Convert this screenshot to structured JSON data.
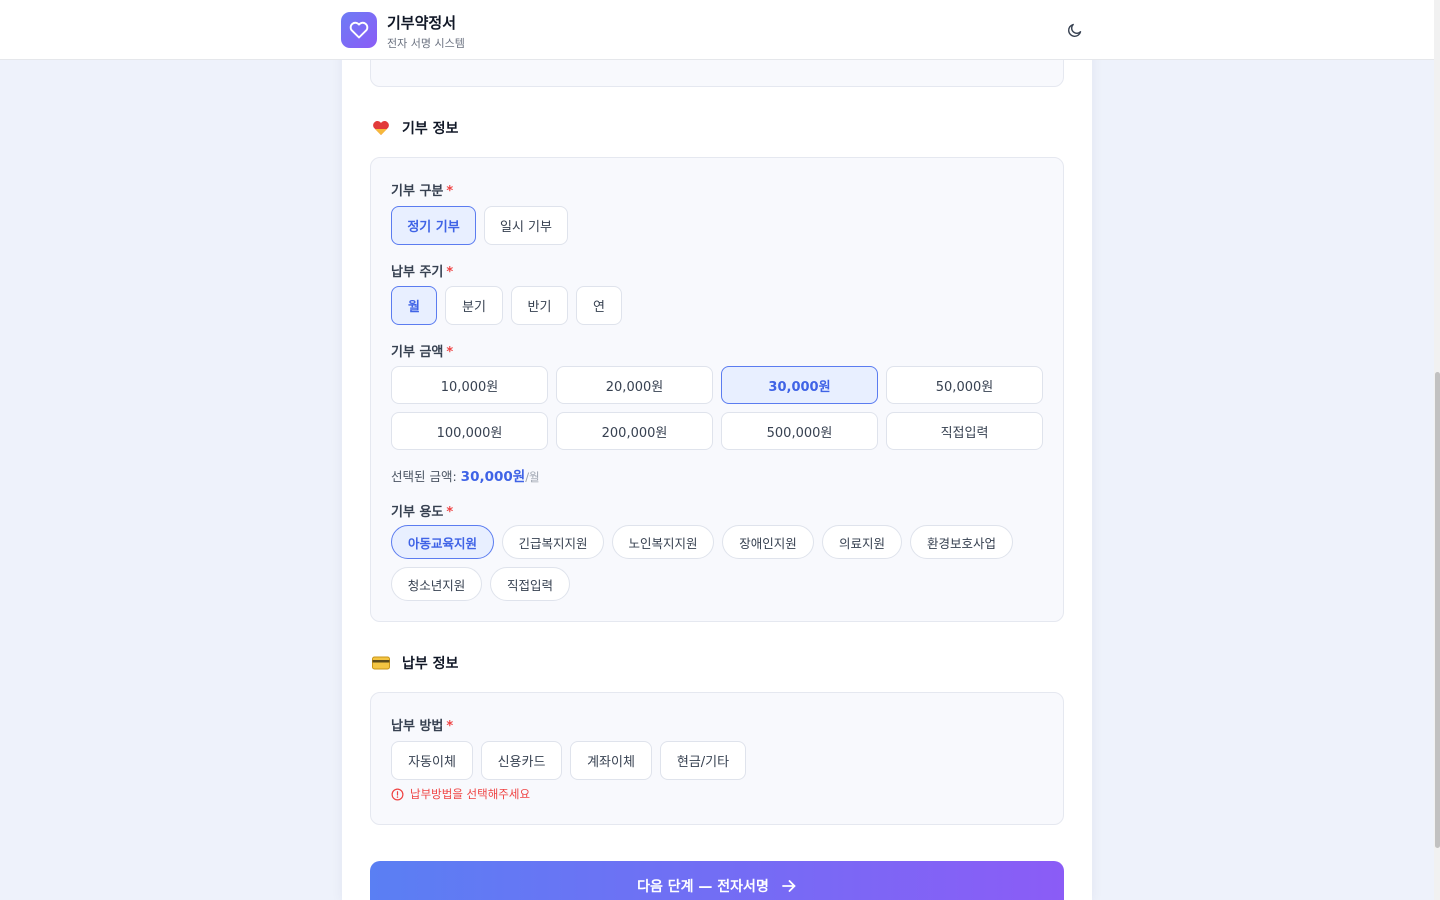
{
  "header": {
    "title": "기부약정서",
    "subtitle": "전자 서명 시스템",
    "logo_icon": "heart-icon",
    "theme_icon": "moon-icon"
  },
  "donation_section": {
    "icon": "heart-emoji",
    "title": "기부 정보",
    "type_label": "기부 구분",
    "types": [
      "정기 기부",
      "일시 기부"
    ],
    "type_selected": "정기 기부",
    "cycle_label": "납부 주기",
    "cycles": [
      "월",
      "분기",
      "반기",
      "연"
    ],
    "cycle_selected": "월",
    "amount_label": "기부 금액",
    "amounts": [
      "10,000원",
      "20,000원",
      "30,000원",
      "50,000원",
      "100,000원",
      "200,000원",
      "500,000원",
      "직접입력"
    ],
    "amount_selected": "30,000원",
    "selected_amount_prefix": "선택된 금액:",
    "selected_amount_value": "30,000원",
    "selected_amount_unit": "/월",
    "purpose_label": "기부 용도",
    "purposes": [
      "아동교육지원",
      "긴급복지지원",
      "노인복지지원",
      "장애인지원",
      "의료지원",
      "환경보호사업",
      "청소년지원",
      "직접입력"
    ],
    "purpose_selected": "아동교육지원"
  },
  "payment_section": {
    "icon": "credit-card-emoji",
    "title": "납부 정보",
    "method_label": "납부 방법",
    "methods": [
      "자동이체",
      "신용카드",
      "계좌이체",
      "현금/기타"
    ],
    "error": "납부방법을 선택해주세요"
  },
  "required_mark": "*",
  "next_button": {
    "label": "다음 단계 — 전자서명",
    "icon": "arrow-right-icon"
  },
  "colors": {
    "accent": "#3f63e6",
    "gradient_start": "#5a7ff3",
    "gradient_end": "#8b5cf6",
    "error": "#ef4444"
  }
}
